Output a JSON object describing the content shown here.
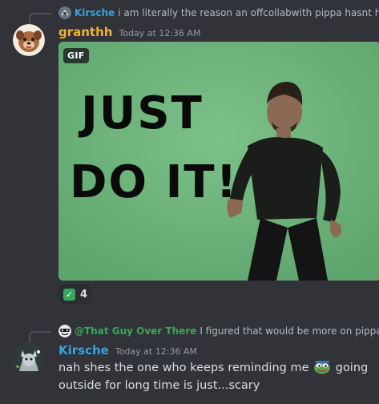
{
  "messages": [
    {
      "reply": {
        "author": "Kirsche",
        "author_color": "#3aa1e0",
        "text": "i am literally the reason an offcollabwith pippa hasnt hap"
      },
      "author": "granthh",
      "author_color": "#f0b232",
      "timestamp": "Today at 12:36 AM",
      "attachment": {
        "badge": "GIF",
        "caption_line1": "JUST",
        "caption_line2": "DO IT!"
      },
      "reaction": {
        "emoji": "✓",
        "count": "4"
      }
    },
    {
      "reply": {
        "author": "@That Guy Over There",
        "author_color": "#3ba55c",
        "text": "I figured that would be more on pippa"
      },
      "author": "Kirsche",
      "author_color": "#3aa1e0",
      "timestamp": "Today at 12:36 AM",
      "text_part1": "nah shes the one who keeps reminding me",
      "text_part2": "going",
      "text_line2": "outside for long time is just...scary"
    }
  ],
  "colors": {
    "background": "#313338",
    "text": "#dbdee1",
    "muted": "#949ba4",
    "gif_background": "#6cb27a"
  },
  "icons": [
    "reply-avatar-icon",
    "check-mark-icon",
    "pepe-emoji-icon"
  ]
}
